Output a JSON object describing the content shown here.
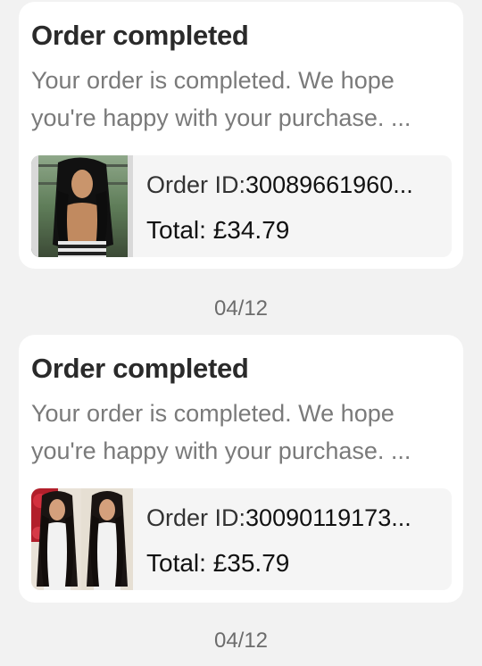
{
  "notifications": [
    {
      "title": "Order completed",
      "body": "Your order is completed. We hope you're happy with your purchase. ...",
      "order_id_label": "Order ID:",
      "order_id_value": "30089661960...",
      "total_label": "Total:",
      "total_value": "£34.79",
      "thumbnail_icon": "product-photo-hair-wig-single-model"
    },
    {
      "title": "Order completed",
      "body": "Your order is completed. We hope you're happy with your purchase. ...",
      "order_id_label": "Order ID:",
      "order_id_value": "30090119173...",
      "total_label": "Total:",
      "total_value": "£35.79",
      "thumbnail_icon": "product-photo-hair-wig-two-models"
    }
  ],
  "dates": [
    "04/12",
    "04/12"
  ]
}
